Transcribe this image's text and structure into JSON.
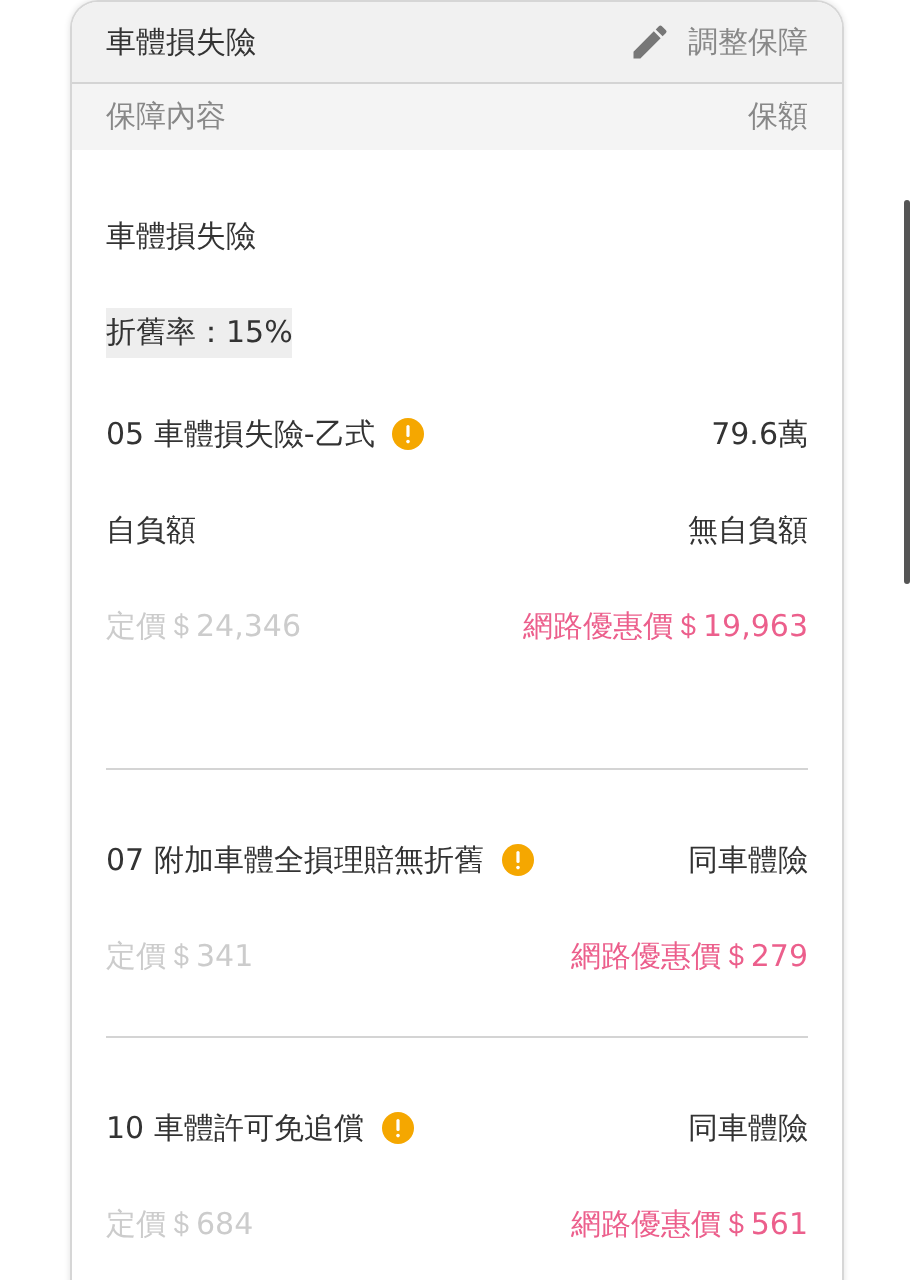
{
  "header": {
    "title": "車體損失險",
    "action": "調整保障"
  },
  "columns": [
    "保障內容",
    "保額"
  ],
  "section": {
    "title": "車體損失險",
    "depreciation": "折舊率：15%",
    "coverage": {
      "name": "05 車體損失險-乙式",
      "amount": "79.6萬",
      "deductible_label": "自負額",
      "deductible": "無自負額",
      "list_price": "定價＄24,346",
      "online_price": "網路優惠價＄19,963"
    }
  },
  "riders": [
    {
      "name": "07 附加車體全損理賠無折舊",
      "amount": "同車體險",
      "list_price": "定價＄341",
      "online_price": "網路優惠價＄279"
    },
    {
      "name": "10 車體許可免追償",
      "amount": "同車體險",
      "list_price": "定價＄684",
      "online_price": "網路優惠價＄561"
    }
  ]
}
